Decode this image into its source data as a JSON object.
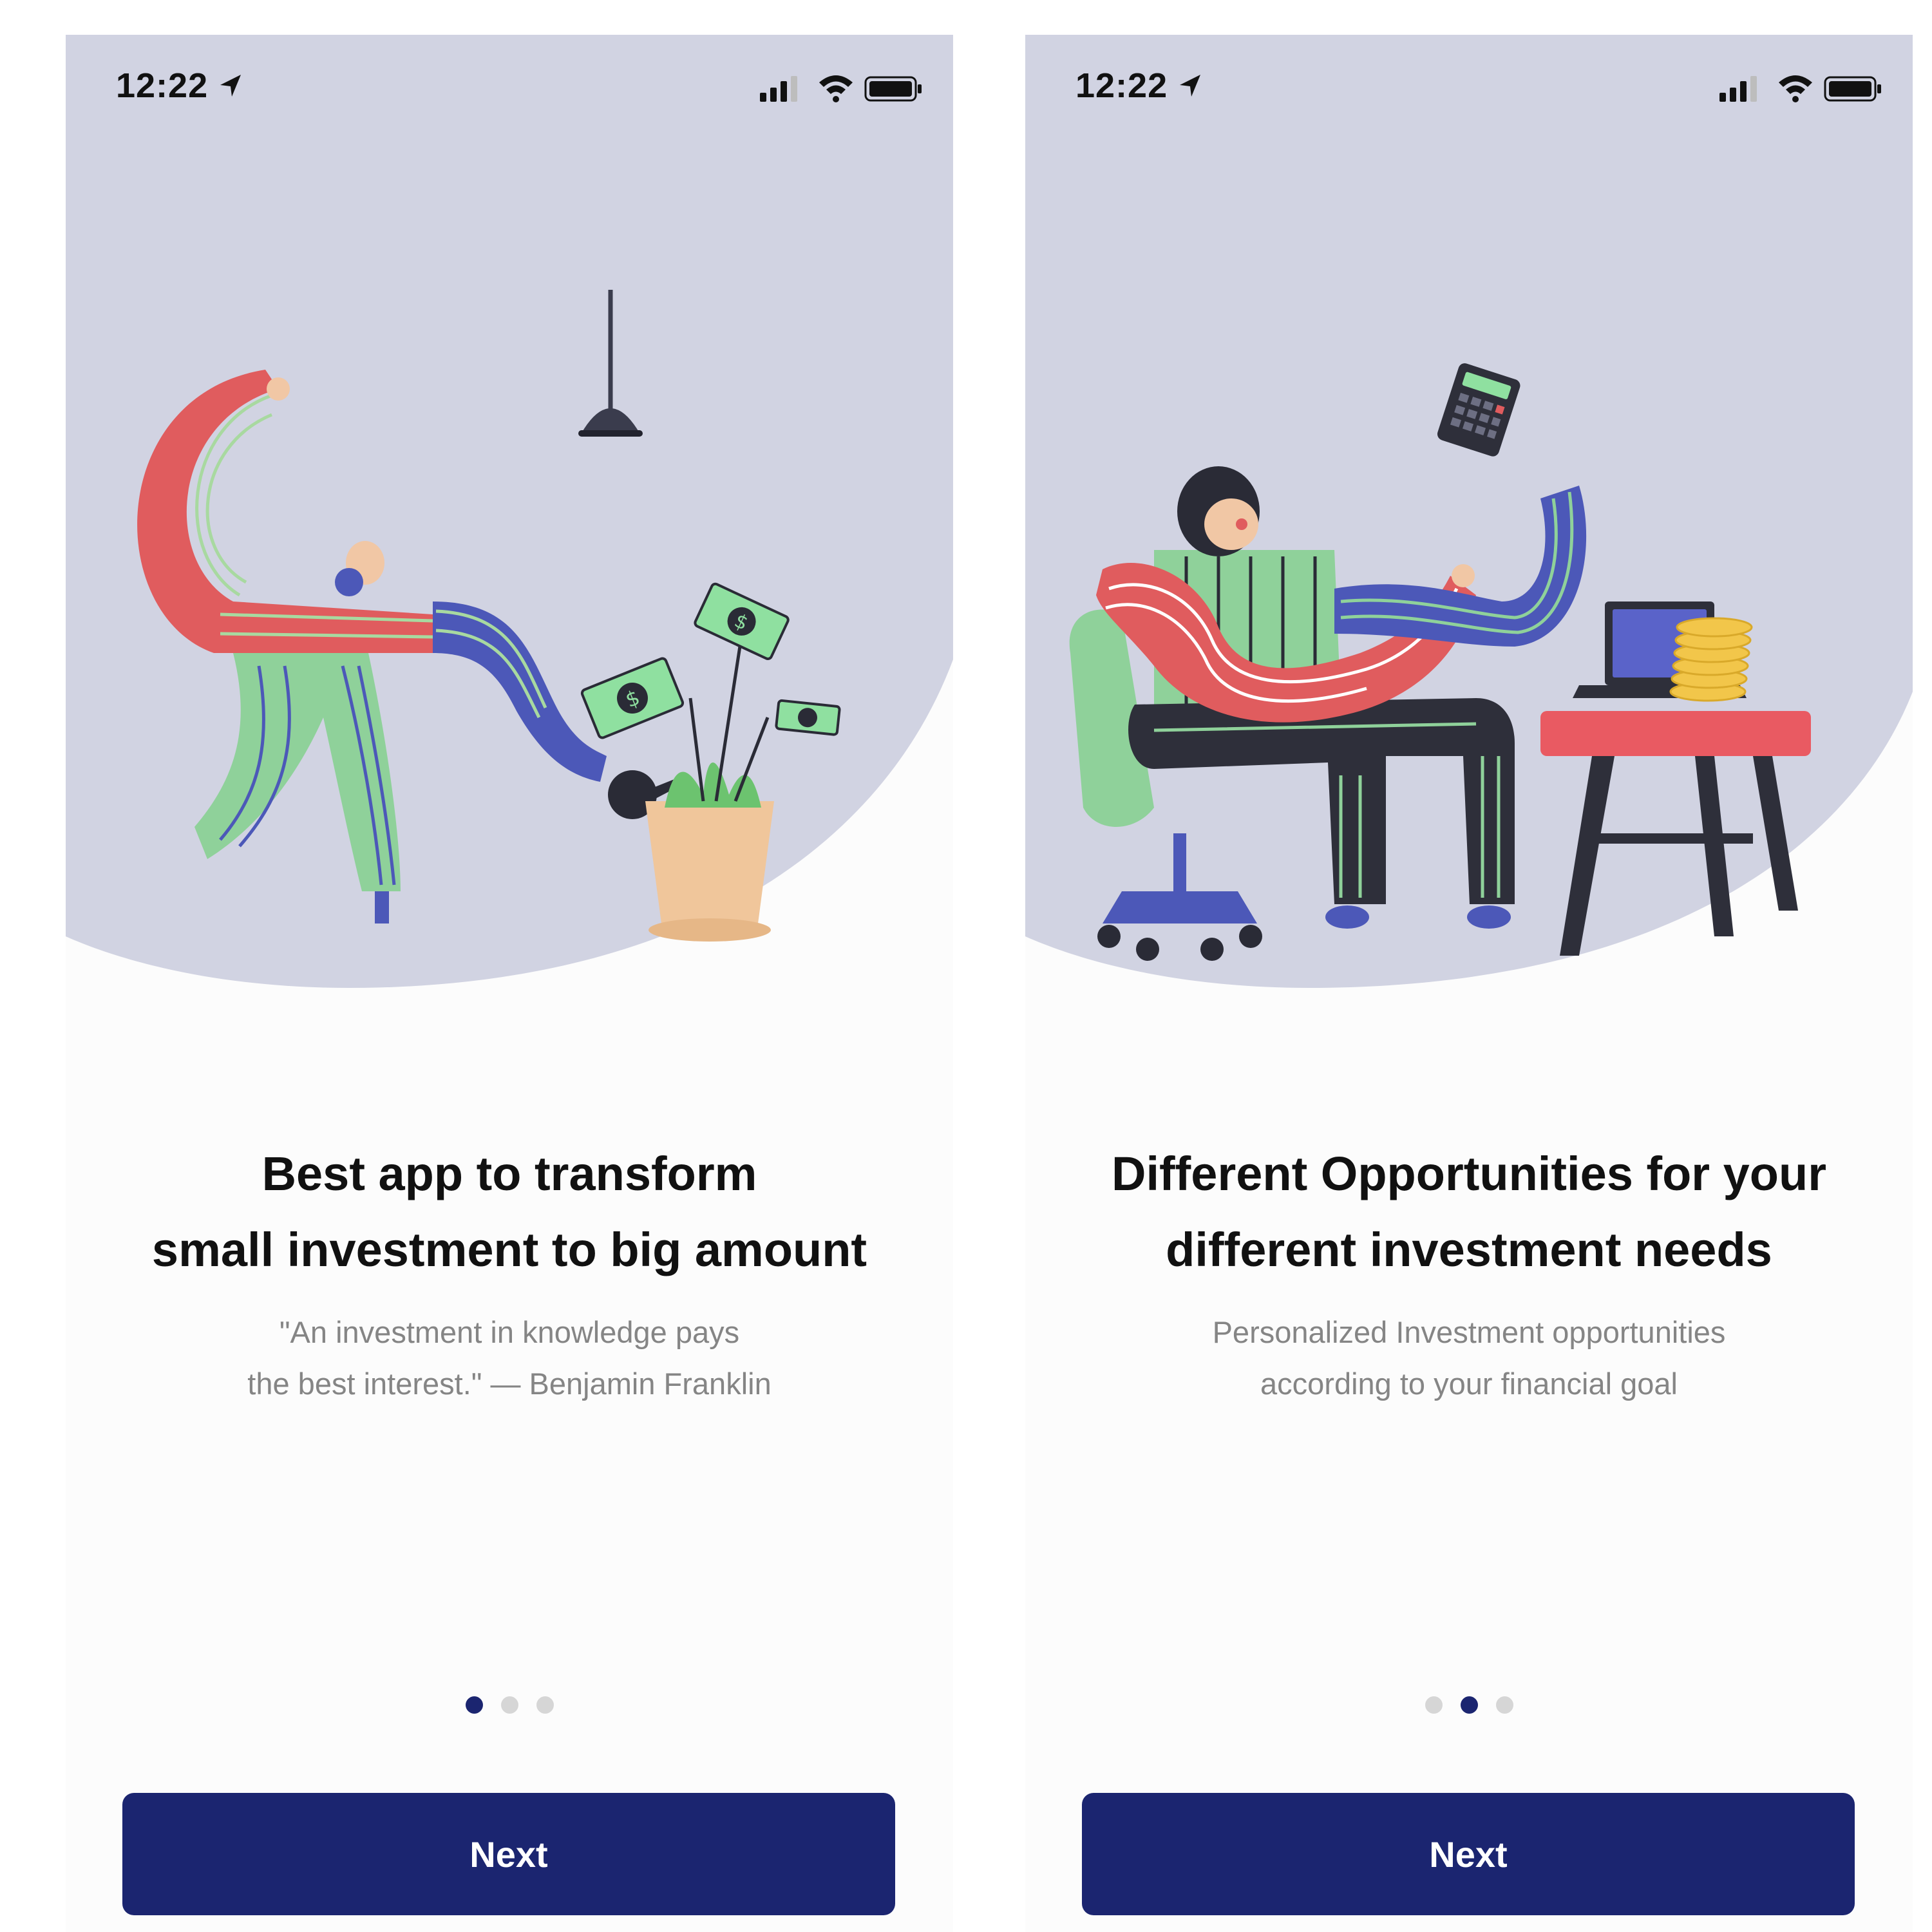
{
  "colors": {
    "hero_bg": "#d1d3e2",
    "button_bg": "#1b2570",
    "dot_active": "#1b2570",
    "dot_inactive": "#d6d6d6",
    "title": "#111111",
    "subtitle": "#858585"
  },
  "status_bar": {
    "time": "12:22",
    "icons": [
      "location-arrow-icon",
      "signal-icon",
      "wifi-icon",
      "battery-icon"
    ]
  },
  "screens": [
    {
      "title_lines": [
        "Best app to transform",
        "small investment to big amount"
      ],
      "subtitle_lines": [
        "\"An investment in knowledge pays",
        "the best interest.\" — Benjamin Franklin"
      ],
      "page_indicator": {
        "count": 3,
        "active_index": 0
      },
      "button_label": "Next",
      "illustration": "person-watering-money-plant"
    },
    {
      "title_lines": [
        "Different Opportunities for your",
        "different investment needs"
      ],
      "subtitle_lines": [
        "Personalized Investment opportunities",
        "according to your financial goal"
      ],
      "page_indicator": {
        "count": 3,
        "active_index": 1
      },
      "button_label": "Next",
      "illustration": "person-at-desk-with-calculator"
    }
  ]
}
